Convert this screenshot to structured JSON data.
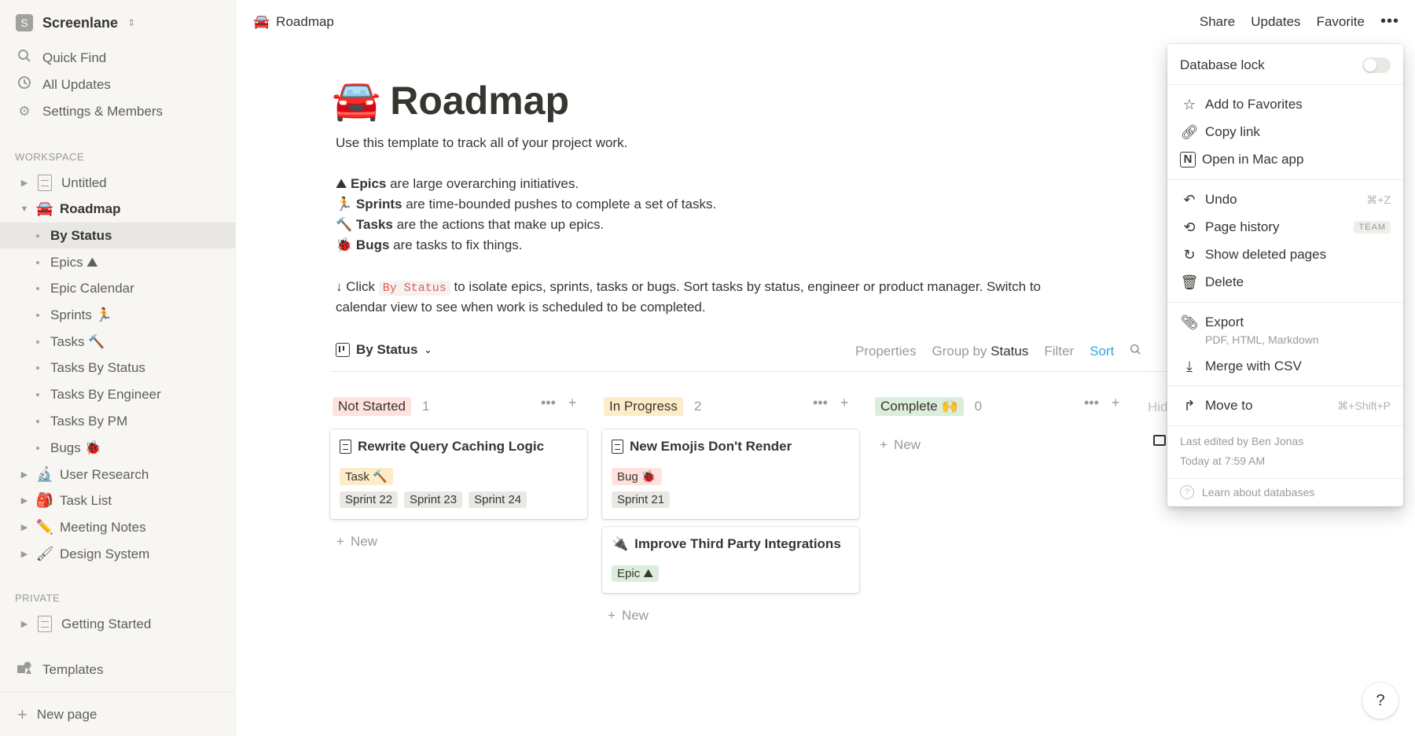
{
  "workspace": {
    "avatar_letter": "S",
    "name": "Screenlane",
    "switch_icon": "⌃⌄"
  },
  "sidebar": {
    "top_items": [
      {
        "icon": "search-icon",
        "label": "Quick Find"
      },
      {
        "icon": "clock-icon",
        "label": "All Updates"
      },
      {
        "icon": "gear-icon",
        "label": "Settings & Members"
      }
    ],
    "workspace_label": "WORKSPACE",
    "pages": [
      {
        "label": "Untitled",
        "emoji": ""
      },
      {
        "label": "Roadmap",
        "emoji": "🚘"
      },
      {
        "label": "By Status"
      },
      {
        "label": "Epics ⛰"
      },
      {
        "label": "Epic Calendar"
      },
      {
        "label": "Sprints 🏃"
      },
      {
        "label": "Tasks 🔨"
      },
      {
        "label": "Tasks By Status"
      },
      {
        "label": "Tasks By Engineer"
      },
      {
        "label": "Tasks By PM"
      },
      {
        "label": "Bugs 🐞"
      },
      {
        "label": "User Research",
        "emoji": "🔬"
      },
      {
        "label": "Task List",
        "emoji": "🎒"
      },
      {
        "label": "Meeting Notes",
        "emoji": "✏️"
      },
      {
        "label": "Design System",
        "emoji": "🖌"
      }
    ],
    "private_label": "PRIVATE",
    "private_pages": [
      {
        "label": "Getting Started"
      }
    ],
    "templates_label": "Templates",
    "new_page_label": "New page"
  },
  "topbar": {
    "breadcrumb_emoji": "🚘",
    "breadcrumb": "Roadmap",
    "share": "Share",
    "updates": "Updates",
    "favorite": "Favorite",
    "more": "•••"
  },
  "page": {
    "emoji": "🚘",
    "title": "Roadmap",
    "intro": "Use this template to track all of your project work.",
    "lines": [
      {
        "emoji": "⛰",
        "bold": "Epics",
        "rest": " are large overarching initiatives."
      },
      {
        "emoji": "🏃",
        "bold": "Sprints",
        "rest": " are time-bounded pushes to complete a set of tasks."
      },
      {
        "emoji": "🔨",
        "bold": "Tasks",
        "rest": " are the actions that make up epics."
      },
      {
        "emoji": "🐞",
        "bold": "Bugs",
        "rest": " are tasks to fix things."
      }
    ],
    "click_prefix": "↓ Click ",
    "click_code": "By Status",
    "click_rest": " to isolate epics, sprints, tasks or bugs. Sort tasks by status, engineer or product manager. Switch to",
    "click_line2": "calendar view to see when work is scheduled to be completed."
  },
  "view": {
    "name": "By Status",
    "properties": "Properties",
    "group_by": "Group by",
    "group_value": "Status",
    "filter": "Filter",
    "sort": "Sort"
  },
  "board": {
    "columns": [
      {
        "name": "Not Started",
        "count": "1",
        "color": "#ffe2dd"
      },
      {
        "name": "In Progress",
        "count": "2",
        "color": "#fdecc8"
      },
      {
        "name": "Complete 🙌",
        "count": "0",
        "color": "#dbeddb"
      }
    ],
    "hidden_label": "Hid",
    "new_label": "New",
    "cards": [
      {
        "title": "Rewrite Query Caching Logic",
        "type": "Task 🔨",
        "type_color": "#fdecc8",
        "sprints": [
          "Sprint 22",
          "Sprint 23",
          "Sprint 24"
        ]
      },
      {
        "title": "New Emojis Don't Render",
        "type": "Bug 🐞",
        "type_color": "#ffe2dd",
        "sprints": [
          "Sprint 21"
        ]
      },
      {
        "title": "Improve Third Party Integrations",
        "emoji": "🔌",
        "type": "Epic ⛰",
        "type_color": "#dbeddb"
      }
    ],
    "sprint_chip_color": "#e9e8e5"
  },
  "menu": {
    "database_lock": "Database lock",
    "database_lock_on": false,
    "add_favorites": "Add to Favorites",
    "copy_link": "Copy link",
    "open_mac": "Open in Mac app",
    "undo": "Undo",
    "undo_shortcut": "⌘+Z",
    "page_history": "Page history",
    "team_badge": "TEAM",
    "show_deleted": "Show deleted pages",
    "delete": "Delete",
    "export": "Export",
    "export_sub": "PDF, HTML, Markdown",
    "merge_csv": "Merge with CSV",
    "move_to": "Move to",
    "move_shortcut": "⌘+Shift+P",
    "last_edited": "Last edited by Ben Jonas",
    "edited_time": "Today at 7:59 AM",
    "learn": "Learn about databases"
  },
  "help": "?"
}
